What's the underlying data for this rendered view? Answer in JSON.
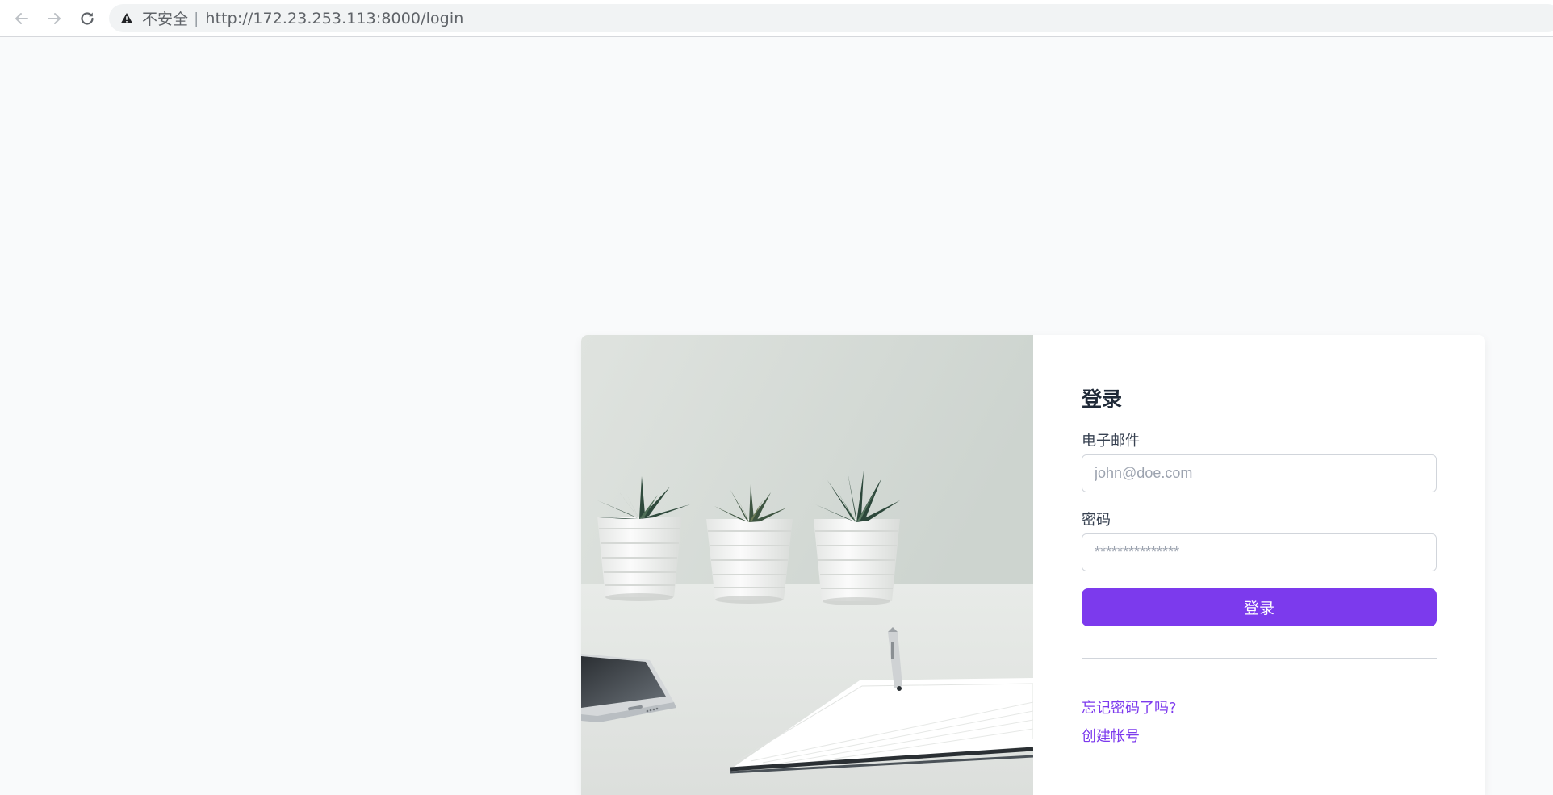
{
  "browser": {
    "security_label": "不安全",
    "separator": "|",
    "url": "http://172.23.253.113:8000/login",
    "icons": {
      "back": "arrow-left-icon",
      "forward": "arrow-right-icon",
      "reload": "reload-icon",
      "security": "warning-triangle-icon"
    }
  },
  "login": {
    "title": "登录",
    "email_label": "电子邮件",
    "email_placeholder": "john@doe.com",
    "email_value": "",
    "password_label": "密码",
    "password_placeholder": "***************",
    "password_value": "",
    "submit_label": "登录",
    "forgot_link": "忘记密码了吗?",
    "create_link": "创建帐号"
  },
  "colors": {
    "accent": "#7c3aed",
    "page_background": "#f9fafb",
    "card_background": "#ffffff"
  }
}
